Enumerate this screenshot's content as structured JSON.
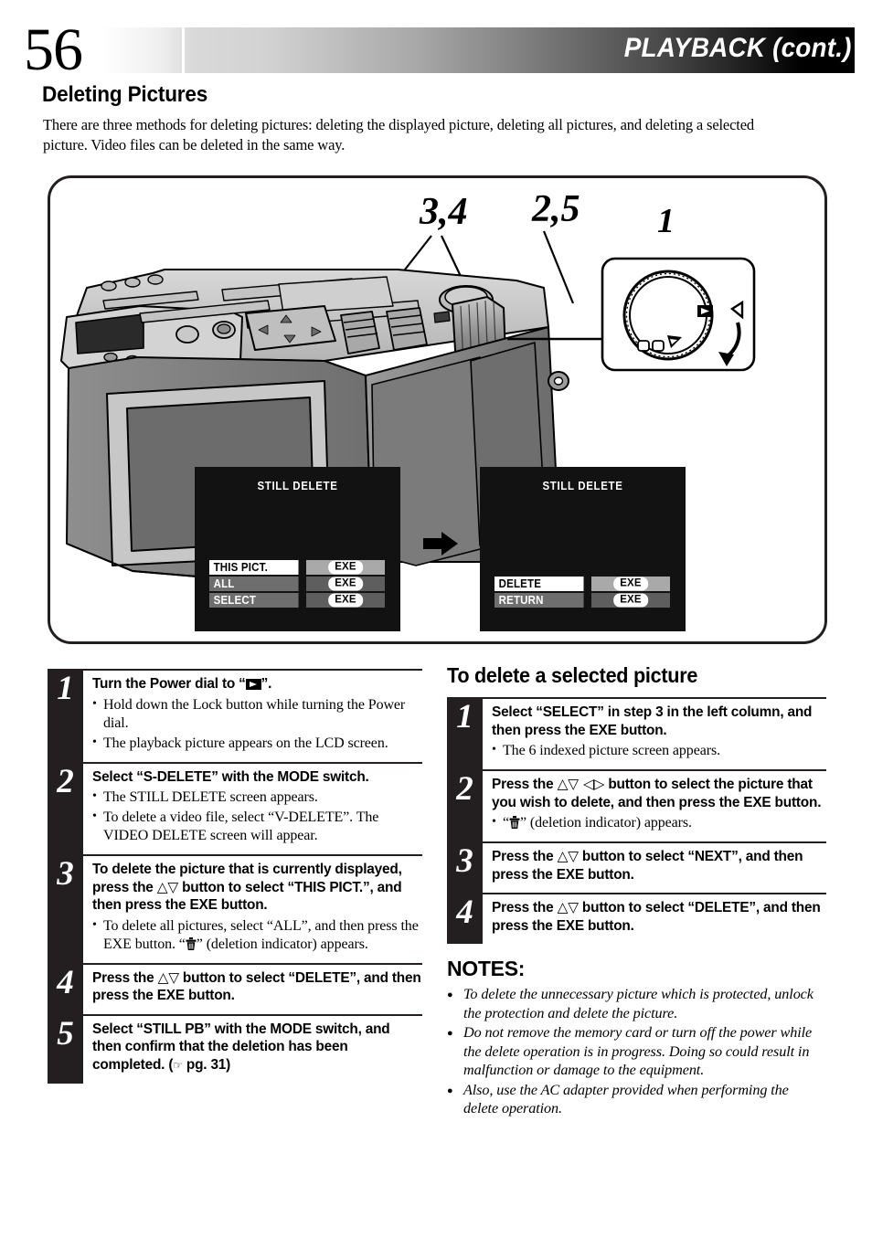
{
  "header": {
    "page_number": "56",
    "title": "PLAYBACK (cont.)"
  },
  "section": {
    "title": "Deleting Pictures",
    "intro": "There are three methods for deleting pictures: deleting the displayed picture, deleting all pictures, and deleting a selected picture. Video files can be deleted in the same way."
  },
  "illustration": {
    "callouts": {
      "buttons_34": "3,4",
      "mode_25": "2,5",
      "dial_1": "1"
    },
    "dial_detail_icons": [
      "playback-triangle",
      "pointer-triangle",
      "rotate-arrow"
    ],
    "screens": [
      {
        "name": "still-delete-first",
        "title": "STILL DELETE",
        "rows": [
          {
            "label": "THIS PICT.",
            "value": "EXE",
            "selected": true
          },
          {
            "label": "ALL",
            "value": "EXE",
            "selected": false
          },
          {
            "label": "SELECT",
            "value": "EXE",
            "selected": false
          }
        ]
      },
      {
        "name": "still-delete-confirm",
        "title": "STILL DELETE",
        "rows": [
          {
            "label": "DELETE",
            "value": "EXE",
            "selected": true
          },
          {
            "label": "RETURN",
            "value": "EXE",
            "selected": false
          }
        ]
      }
    ],
    "flow_arrow": "right-arrow-icon"
  },
  "left_steps": [
    {
      "number": "1",
      "headline_parts": [
        "Turn the Power dial to “",
        "”."
      ],
      "headline_icon": "playback-icon",
      "bullets": [
        "Hold down the Lock button while turning the Power dial.",
        "The playback picture appears on the LCD screen."
      ]
    },
    {
      "number": "2",
      "headline": "Select “S-DELETE” with the MODE switch.",
      "bullets": [
        "The STILL DELETE screen appears.",
        "To delete a video file, select “V-DELETE”. The VIDEO DELETE screen will appear."
      ]
    },
    {
      "number": "3",
      "headline_a": "To delete the picture that is currently displayed, press the ",
      "headline_b": " button to select “THIS PICT.”, and then press the EXE button.",
      "bullet_a": "To delete all pictures, select “ALL”, and then press the EXE button. “",
      "bullet_b": "” (deletion indicator) appears."
    },
    {
      "number": "4",
      "headline_a": "Press the ",
      "headline_b": " button to select “DELETE”, and then press the EXE button."
    },
    {
      "number": "5",
      "headline": "Select “STILL PB” with the MODE switch, and then confirm that the deletion has been completed. (",
      "headline_tail": " pg. 31)"
    }
  ],
  "right_column": {
    "title": "To delete a selected picture",
    "steps": [
      {
        "number": "1",
        "headline": "Select “SELECT” in step 3 in the left column, and then press the EXE button.",
        "bullets": [
          "The 6 indexed picture screen appears."
        ]
      },
      {
        "number": "2",
        "headline_a": "Press the ",
        "headline_b": " button to select the picture that you wish to delete, and then press the EXE button.",
        "bullet_a": "“",
        "bullet_b": "” (deletion indicator) appears."
      },
      {
        "number": "3",
        "headline_a": "Press the ",
        "headline_b": " button to select “NEXT”, and then press the EXE button."
      },
      {
        "number": "4",
        "headline_a": "Press the ",
        "headline_b": " button to select “DELETE”, and then press the EXE button."
      }
    ],
    "notes_heading": "NOTES:",
    "notes": [
      "To delete the unnecessary picture which is protected, unlock the protection and delete the picture.",
      "Do not remove the memory card or turn off the power while the delete operation is in progress. Doing so could result in malfunction or damage to the equipment.",
      "Also, use the AC adapter provided when performing the delete operation."
    ]
  },
  "colors": {
    "ink": "#231f20",
    "lcd_background": "#121212",
    "lcd_selected_row": "#ffffff",
    "lcd_unselected_row": "#6e6e6e"
  }
}
